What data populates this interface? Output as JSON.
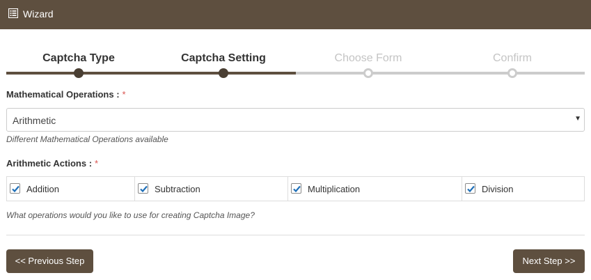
{
  "header": {
    "title": "Wizard",
    "icon": "list-icon"
  },
  "steps": [
    {
      "label": "Captcha Type",
      "state": "complete"
    },
    {
      "label": "Captcha Setting",
      "state": "current"
    },
    {
      "label": "Choose Form",
      "state": "pending"
    },
    {
      "label": "Confirm",
      "state": "pending"
    }
  ],
  "math_operations": {
    "label": "Mathematical Operations :",
    "required_mark": "*",
    "selected": "Arithmetic",
    "help": "Different Mathematical Operations available"
  },
  "arithmetic_actions": {
    "label": "Arithmetic Actions :",
    "required_mark": "*",
    "options": [
      {
        "label": "Addition",
        "checked": true
      },
      {
        "label": "Subtraction",
        "checked": true
      },
      {
        "label": "Multiplication",
        "checked": true
      },
      {
        "label": "Division",
        "checked": true
      }
    ],
    "help": "What operations would you like to use for creating Captcha Image?"
  },
  "buttons": {
    "previous": "<< Previous Step",
    "next": "Next Step >>"
  },
  "colors": {
    "brand": "#5e4f3f",
    "track_pending": "#cccccc",
    "required": "#d9534f",
    "checkmark": "#1e6fb8"
  }
}
